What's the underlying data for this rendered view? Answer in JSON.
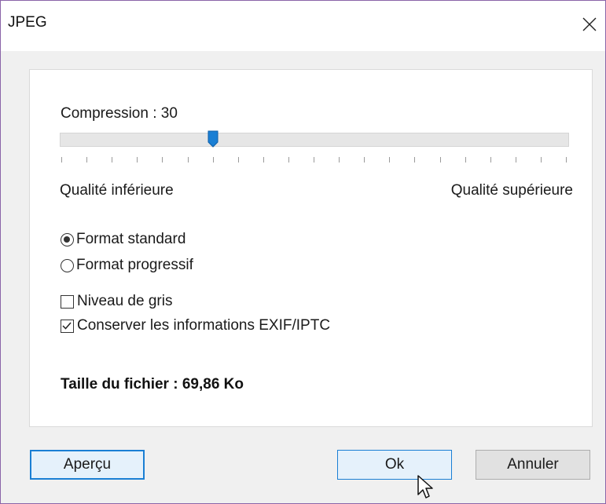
{
  "window": {
    "title": "JPEG",
    "close_icon": "close-icon"
  },
  "compression": {
    "label": "Compression : 30",
    "value": 30,
    "min": 0,
    "max": 100,
    "tick_count": 21,
    "low_label": "Qualité inférieure",
    "high_label": "Qualité supérieure",
    "accent": "#1a7fd4"
  },
  "format": {
    "options": [
      {
        "label": "Format standard",
        "checked": true
      },
      {
        "label": "Format progressif",
        "checked": false
      }
    ]
  },
  "checkboxes": {
    "grayscale": {
      "label": "Niveau de gris",
      "checked": false
    },
    "exif": {
      "label": "Conserver les informations EXIF/IPTC",
      "checked": true
    }
  },
  "filesize": {
    "text": "Taille du fichier : 69,86 Ko"
  },
  "buttons": {
    "preview": "Aperçu",
    "ok": "Ok",
    "cancel": "Annuler"
  }
}
